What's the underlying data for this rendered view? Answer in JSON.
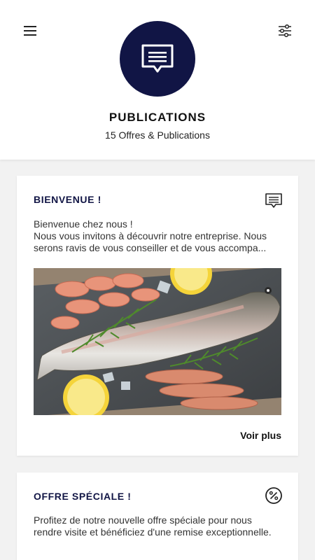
{
  "header": {
    "menu_icon": "hamburger-menu-icon",
    "filter_icon": "sliders-filter-icon",
    "logo_icon": "message-bubble-icon",
    "title": "PUBLICATIONS",
    "subtitle": "15 Offres & Publications",
    "accent_color": "#111545"
  },
  "posts": [
    {
      "title": "BIENVENUE !",
      "icon": "message-icon",
      "lines": [
        "Bienvenue chez nous !",
        "Nous vous invitons à découvrir notre entreprise. Nous",
        "serons ravis de vous conseiller et de vous accompa..."
      ],
      "image": "seafood-trout-shrimp-lemon-photo",
      "action_label": "Voir plus"
    },
    {
      "title": "OFFRE SPÉCIALE !",
      "icon": "percent-badge-icon",
      "lines": [
        "Profitez de notre nouvelle offre spéciale pour nous",
        "rendre visite et bénéficiez d'une remise exceptionnelle."
      ]
    }
  ]
}
